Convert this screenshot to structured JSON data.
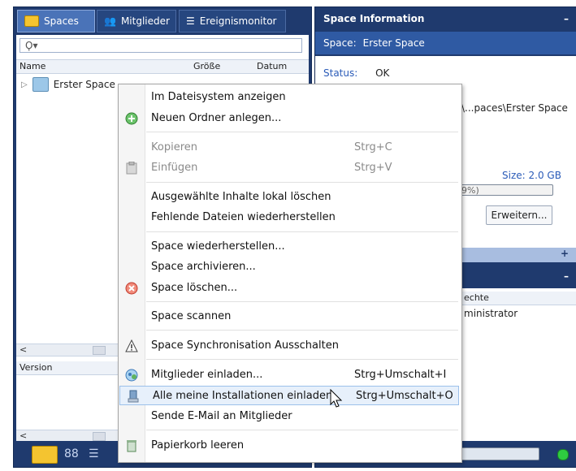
{
  "left_panel": {
    "tabs": [
      {
        "label": "Spaces"
      },
      {
        "label": "Mitglieder"
      },
      {
        "label": "Ereignismonitor"
      }
    ],
    "search": {
      "placeholder": "Ϙ▾"
    },
    "columns": [
      "Name",
      "Größe",
      "Datum"
    ],
    "tree": [
      {
        "label": "Erster Space"
      }
    ],
    "bottom_columns": [
      "Version"
    ]
  },
  "right_panel": {
    "header": "Space Information",
    "space_label": "Space:",
    "space_value": "Erster Space",
    "status_label": "Status:",
    "status_value": "OK",
    "path_value": "\\...paces\\Erster Space",
    "size_text": "Size: 2.0 GB",
    "progress_text": "9%)",
    "extend_button": "Erweitern...",
    "plus": "+",
    "minus": "–",
    "members_column": "echte",
    "members_value": "ministrator"
  },
  "context_menu": {
    "items": [
      {
        "label": "Im Dateisystem anzeigen",
        "shortcut": "",
        "icon": "",
        "enabled": true
      },
      {
        "label": "Neuen Ordner anlegen...",
        "shortcut": "",
        "icon": "add-folder-icon",
        "enabled": true
      },
      {
        "label": "Kopieren",
        "shortcut": "Strg+C",
        "icon": "",
        "enabled": false
      },
      {
        "label": "Einfügen",
        "shortcut": "Strg+V",
        "icon": "paste-icon",
        "enabled": false
      },
      {
        "label": "Ausgewählte Inhalte lokal löschen",
        "shortcut": "",
        "icon": "",
        "enabled": true
      },
      {
        "label": "Fehlende Dateien wiederherstellen",
        "shortcut": "",
        "icon": "",
        "enabled": true
      },
      {
        "label": "Space wiederherstellen...",
        "shortcut": "",
        "icon": "",
        "enabled": true
      },
      {
        "label": "Space archivieren...",
        "shortcut": "",
        "icon": "",
        "enabled": true
      },
      {
        "label": "Space löschen...",
        "shortcut": "",
        "icon": "delete-icon",
        "enabled": true
      },
      {
        "label": "Space scannen",
        "shortcut": "",
        "icon": "",
        "enabled": true
      },
      {
        "label": "Space Synchronisation Ausschalten",
        "shortcut": "",
        "icon": "warning-icon",
        "enabled": true
      },
      {
        "label": "Mitglieder einladen...",
        "shortcut": "Strg+Umschalt+I",
        "icon": "invite-icon",
        "enabled": true
      },
      {
        "label": "Alle meine Installationen einladen",
        "shortcut": "Strg+Umschalt+O",
        "icon": "installations-icon",
        "enabled": true,
        "highlighted": true
      },
      {
        "label": "Sende E-Mail an Mitglieder",
        "shortcut": "",
        "icon": "",
        "enabled": true
      },
      {
        "label": "Papierkorb leeren",
        "shortcut": "",
        "icon": "trash-icon",
        "enabled": true
      }
    ]
  }
}
